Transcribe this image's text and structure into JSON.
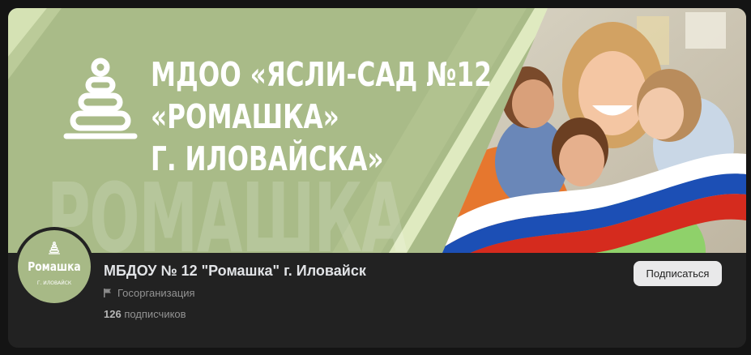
{
  "cover": {
    "title_line1": "МДОО «ЯСЛИ-САД №12",
    "title_line2": "«РОМАШКА»",
    "title_line3": "Г. ИЛОВАЙСКА»",
    "watermark": "РОМАШКА",
    "logo_icon": "pyramid-toy-icon",
    "photo_description_icon": "children-photo",
    "flag_colors": [
      "#ffffff",
      "#1c4fb5",
      "#d52b1e"
    ],
    "bg_color": "#a9bb88"
  },
  "avatar": {
    "name": "Ромашка",
    "city": "Г. ИЛОВАЙСК"
  },
  "group": {
    "name": "МБДОУ № 12 \"Ромашка\" г. Иловайск",
    "type": "Госорганизация",
    "followers_count": "126",
    "followers_label": "подписчиков"
  },
  "actions": {
    "subscribe_label": "Подписаться"
  }
}
